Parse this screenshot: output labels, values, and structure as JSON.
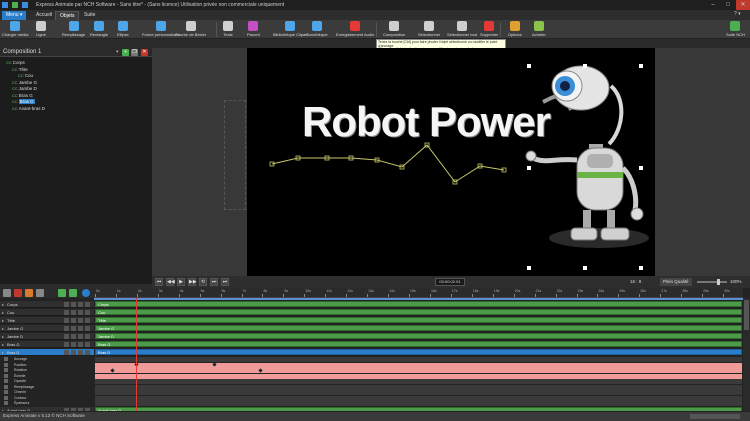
{
  "window": {
    "title": "Express Animate par NCH Software - Sans titre* - (Sans licence) Utilisation privée non commerciale uniquement"
  },
  "menu_tabs": [
    "Menu",
    "Accueil",
    "Objets",
    "Suite"
  ],
  "menu_arrow": "▾",
  "active_tab": "Objets",
  "help_icons": "? ▾",
  "toolbar": {
    "items": [
      {
        "label": "Charger média",
        "icon": "load-media-icon",
        "color": "#4ea6e8"
      },
      {
        "label": "Ligne",
        "icon": "line-icon",
        "color": "#cfcfcf"
      },
      {
        "label": "Remplissage",
        "icon": "fill-icon",
        "color": "#4ea6e8"
      },
      {
        "label": "Rectangle",
        "icon": "rectangle-icon",
        "color": "#4ea6e8"
      },
      {
        "label": "Ellipse",
        "icon": "ellipse-icon",
        "color": "#4ea6e8"
      },
      {
        "label": "Forme personnalisée",
        "icon": "custom-shape-icon",
        "color": "#4ea6e8"
      },
      {
        "label": "Courbe de Bézier",
        "icon": "bezier-icon",
        "color": "#cfcfcf"
      },
      {
        "label": "Texte",
        "icon": "text-icon",
        "color": "#cfcfcf"
      },
      {
        "label": "Panorit",
        "icon": "pattern-icon",
        "color": "#c44fc4"
      },
      {
        "label": "Bibliothèque Clipart",
        "icon": "clipart-icon",
        "color": "#4ea6e8"
      },
      {
        "label": "Sonothèque",
        "icon": "sound-library-icon",
        "color": "#4ea6e8"
      },
      {
        "label": "Enregistrement Audio",
        "icon": "record-icon",
        "color": "#e53935"
      },
      {
        "label": "Composition",
        "icon": "composition-icon",
        "color": "#cfcfcf"
      },
      {
        "label": "Sélectionner",
        "icon": "select-icon",
        "color": "#cfcfcf"
      },
      {
        "label": "Sélectionner tout",
        "icon": "select-all-icon",
        "color": "#cfcfcf"
      },
      {
        "label": "Supprimer",
        "icon": "delete-icon",
        "color": "#e53935"
      },
      {
        "label": "Options",
        "icon": "options-icon",
        "color": "#e0a030"
      },
      {
        "label": "Acheter",
        "icon": "buy-icon",
        "color": "#8bc34a"
      }
    ],
    "right_label": "Suite NCH"
  },
  "tooltip": {
    "line1": "Tenez la touche [Ctrl] pour faire pivoter l'objet sélectionné ou modifier le point d'ancrage.",
    "line2": "Cliquez sur l'objet sélectionné pour modifier les poignées de forme."
  },
  "composition": {
    "title": "Composition 1",
    "tree": [
      {
        "label": "Corps",
        "indent": 0
      },
      {
        "label": "Tête",
        "indent": 1
      },
      {
        "label": "Cou",
        "indent": 2
      },
      {
        "label": "Jambe G",
        "indent": 1
      },
      {
        "label": "Jambe D",
        "indent": 1
      },
      {
        "label": "Bras G",
        "indent": 1
      },
      {
        "label": "Bras D",
        "indent": 1,
        "selected": true
      },
      {
        "label": "Avant-bras D",
        "indent": 1
      }
    ],
    "cc_tag": "CC"
  },
  "stage": {
    "text": "Robot Power"
  },
  "playback": {
    "buttons": [
      "⏮",
      "◀◀",
      "▶",
      "▶▶",
      "⟲",
      "⏭",
      "⏭"
    ],
    "timecode": "00:00:02.01",
    "aspect": "16 : 9",
    "quality": "Plein Qualité",
    "zoom": "100%"
  },
  "timeline": {
    "ruler": [
      "0s",
      "1s",
      "2s",
      "3s",
      "4s",
      "5s",
      "6s",
      "7s",
      "8s",
      "9s",
      "10s",
      "11s",
      "12s",
      "13s",
      "14s",
      "15s",
      "16s",
      "17s",
      "18s",
      "19s",
      "20s",
      "21s",
      "22s",
      "23s",
      "24s",
      "25s",
      "26s",
      "27s",
      "28s",
      "29s",
      "30s"
    ],
    "tracks": [
      {
        "name": "Corps",
        "bar": "Corps"
      },
      {
        "name": "Cou",
        "bar": "Cou"
      },
      {
        "name": "Tête",
        "bar": "Tête"
      },
      {
        "name": "Jambe G",
        "bar": "Jambe G"
      },
      {
        "name": "Jambe D",
        "bar": "Jambe D"
      },
      {
        "name": "Bras G",
        "bar": "Bras G"
      },
      {
        "name": "Bras D",
        "bar": "Bras D",
        "selected": true
      }
    ],
    "properties": [
      "Ancrage",
      "Position",
      "Rotation",
      "Échelle",
      "Opacité",
      "Remplissage",
      "Chemin",
      "Contour",
      "Épaisseur"
    ],
    "last_track": {
      "name": "Avant-bras D",
      "bar": "Avant-bras D"
    }
  },
  "statusbar": {
    "text": "Express Animate v 5.13 © NCH Software"
  }
}
